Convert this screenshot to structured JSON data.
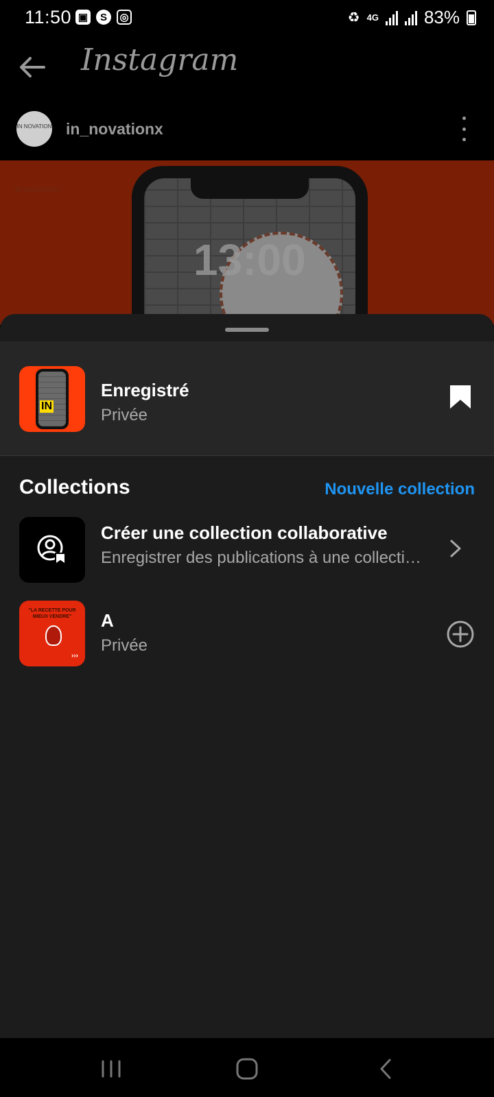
{
  "status_bar": {
    "time": "11:50",
    "network": "4G",
    "battery": "83%",
    "left_icons": [
      "gallery-icon",
      "skype-icon",
      "instagram-icon"
    ]
  },
  "header": {
    "app_title": "Instagram"
  },
  "post": {
    "username": "in_novationx",
    "avatar_text": "IN NOVATION",
    "brand_text": "IN NOVATION",
    "lock_time": "13:00"
  },
  "sheet": {
    "saved": {
      "title": "Enregistré",
      "privacy": "Privée"
    },
    "collections_header": "Collections",
    "new_collection_label": "Nouvelle collection",
    "collaborative": {
      "title": "Créer une collection collaborative",
      "subtitle": "Enregistrer des publications à une collecti…"
    },
    "collections": [
      {
        "name": "A",
        "privacy": "Privée",
        "thumb_text": "\"LA RECETTE POUR MIEUX VENDRE\""
      }
    ]
  },
  "colors": {
    "accent": "#1f95f2",
    "sheet_bg": "#1c1c1c",
    "row_bg": "#262626",
    "post_bg": "#7a1e06"
  }
}
